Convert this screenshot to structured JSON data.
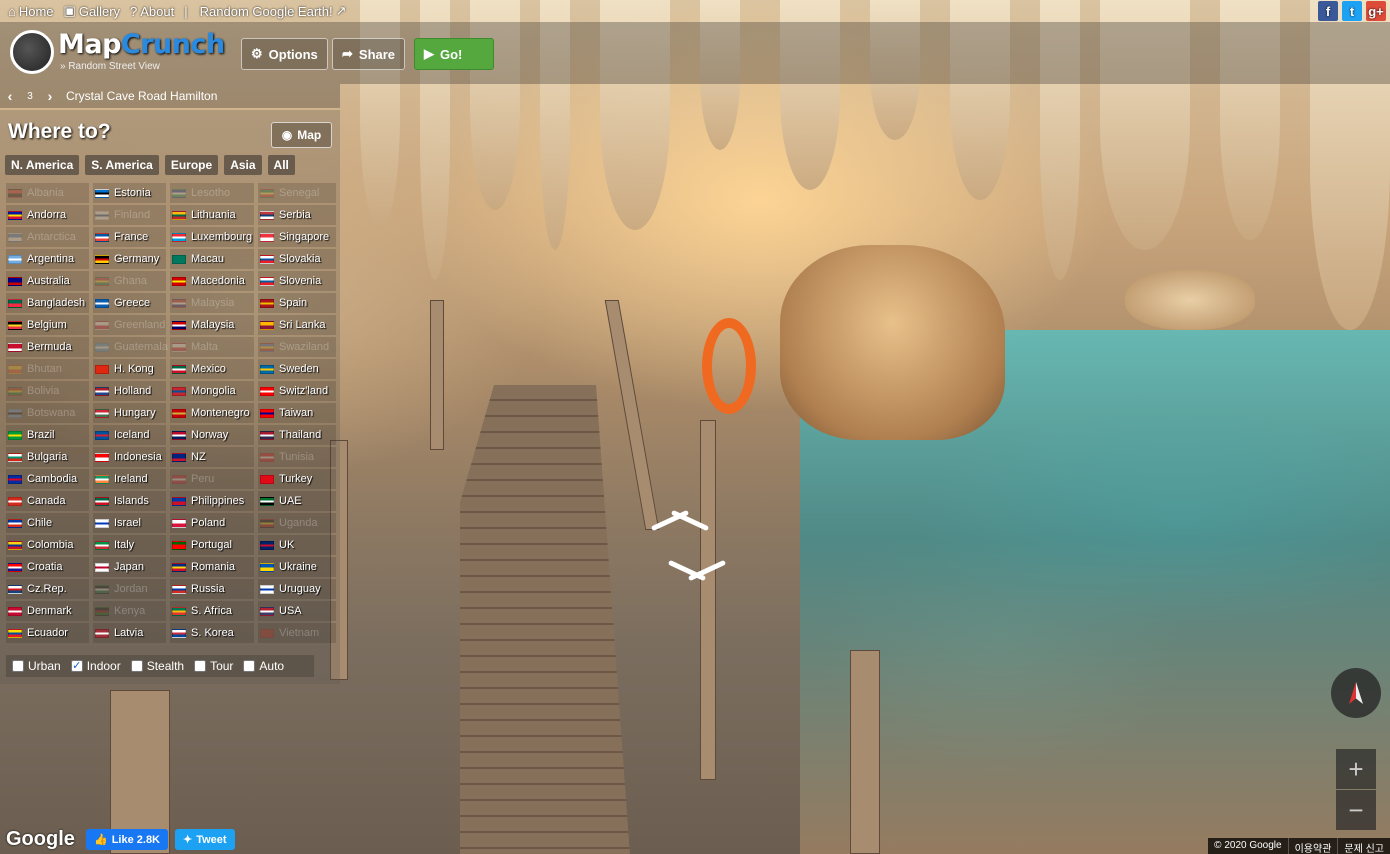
{
  "topnav": {
    "home": "Home",
    "gallery": "Gallery",
    "about": "About",
    "separator": "|",
    "random_earth": "Random Google Earth!"
  },
  "social": {
    "facebook": "f",
    "twitter": "t",
    "googleplus": "g+"
  },
  "header": {
    "logo_map": "Map",
    "logo_crunch": "Crunch",
    "tagline": "» Random Street View",
    "options": "Options",
    "share": "Share",
    "go": "Go!"
  },
  "location": {
    "page": "3",
    "name": "Crystal Cave Road Hamilton"
  },
  "where": {
    "title": "Where to?",
    "map": "Map",
    "regions": [
      "N. America",
      "S. America",
      "Europe",
      "Asia",
      "All"
    ],
    "options": [
      {
        "label": "Urban",
        "checked": false
      },
      {
        "label": "Indoor",
        "checked": true
      },
      {
        "label": "Stealth",
        "checked": false
      },
      {
        "label": "Tour",
        "checked": false
      },
      {
        "label": "Auto",
        "checked": false
      }
    ],
    "columns": [
      [
        {
          "name": "Albania",
          "dim": true,
          "colors": [
            "#e41e20",
            "#000"
          ]
        },
        {
          "name": "Andorra",
          "colors": [
            "#0018a8",
            "#fedf00",
            "#d0103a"
          ]
        },
        {
          "name": "Antarctica",
          "dim": true,
          "colors": [
            "#3a7dce",
            "#fff"
          ]
        },
        {
          "name": "Argentina",
          "colors": [
            "#74acdf",
            "#fff",
            "#74acdf"
          ]
        },
        {
          "name": "Australia",
          "colors": [
            "#00008b",
            "#00008b",
            "#c00"
          ]
        },
        {
          "name": "Bangladesh",
          "colors": [
            "#006a4e",
            "#f42a41"
          ]
        },
        {
          "name": "Belgium",
          "colors": [
            "#000",
            "#fdda24",
            "#ef3340"
          ]
        },
        {
          "name": "Bermuda",
          "colors": [
            "#c8102e",
            "#c8102e",
            "#fff"
          ]
        },
        {
          "name": "Bhutan",
          "dim": true,
          "colors": [
            "#ffd520",
            "#ff4e12"
          ]
        },
        {
          "name": "Bolivia",
          "dim": true,
          "colors": [
            "#d52b1e",
            "#f9e300",
            "#007934"
          ]
        },
        {
          "name": "Botswana",
          "dim": true,
          "colors": [
            "#75aadb",
            "#000",
            "#75aadb"
          ]
        },
        {
          "name": "Brazil",
          "colors": [
            "#009c3b",
            "#ffdf00",
            "#009c3b"
          ]
        },
        {
          "name": "Bulgaria",
          "colors": [
            "#fff",
            "#00966e",
            "#d62612"
          ]
        },
        {
          "name": "Cambodia",
          "colors": [
            "#032ea1",
            "#e00025",
            "#032ea1"
          ]
        },
        {
          "name": "Canada",
          "colors": [
            "#d52b1e",
            "#fff",
            "#d52b1e"
          ]
        },
        {
          "name": "Chile",
          "colors": [
            "#0039a6",
            "#fff",
            "#d52b1e"
          ]
        },
        {
          "name": "Colombia",
          "colors": [
            "#fcd116",
            "#003893",
            "#ce1126"
          ]
        },
        {
          "name": "Croatia",
          "colors": [
            "#ff0000",
            "#fff",
            "#171796"
          ]
        },
        {
          "name": "Cz.Rep.",
          "colors": [
            "#fff",
            "#d7141a",
            "#11457e"
          ]
        },
        {
          "name": "Denmark",
          "colors": [
            "#c60c30",
            "#fff",
            "#c60c30"
          ]
        },
        {
          "name": "Ecuador",
          "colors": [
            "#ffdd00",
            "#034ea2",
            "#ed1c24"
          ]
        }
      ],
      [
        {
          "name": "Estonia",
          "colors": [
            "#0072ce",
            "#000",
            "#fff"
          ]
        },
        {
          "name": "Finland",
          "dim": true,
          "colors": [
            "#fff",
            "#003580",
            "#fff"
          ]
        },
        {
          "name": "France",
          "colors": [
            "#0055a4",
            "#fff",
            "#ef4135"
          ]
        },
        {
          "name": "Germany",
          "colors": [
            "#000",
            "#dd0000",
            "#ffce00"
          ]
        },
        {
          "name": "Ghana",
          "dim": true,
          "colors": [
            "#ce1126",
            "#fcd116",
            "#006b3f"
          ]
        },
        {
          "name": "Greece",
          "colors": [
            "#0d5eaf",
            "#fff",
            "#0d5eaf"
          ]
        },
        {
          "name": "Greenland",
          "dim": true,
          "colors": [
            "#fff",
            "#d00c33"
          ]
        },
        {
          "name": "Guatemala",
          "dim": true,
          "colors": [
            "#4997d0",
            "#fff",
            "#4997d0"
          ]
        },
        {
          "name": "H. Kong",
          "colors": [
            "#de2910",
            "#de2910"
          ]
        },
        {
          "name": "Holland",
          "colors": [
            "#ae1c28",
            "#fff",
            "#21468b"
          ]
        },
        {
          "name": "Hungary",
          "colors": [
            "#ce2939",
            "#fff",
            "#477050"
          ]
        },
        {
          "name": "Iceland",
          "colors": [
            "#02529c",
            "#dc1e35",
            "#02529c"
          ]
        },
        {
          "name": "Indonesia",
          "colors": [
            "#ff0000",
            "#fff"
          ]
        },
        {
          "name": "Ireland",
          "colors": [
            "#169b62",
            "#fff",
            "#ff883e"
          ]
        },
        {
          "name": "Islands",
          "colors": [
            "#006847",
            "#fff",
            "#ce1126"
          ]
        },
        {
          "name": "Israel",
          "colors": [
            "#fff",
            "#0038b8",
            "#fff"
          ]
        },
        {
          "name": "Italy",
          "colors": [
            "#009246",
            "#fff",
            "#ce2b37"
          ]
        },
        {
          "name": "Japan",
          "colors": [
            "#fff",
            "#bc002d",
            "#fff"
          ]
        },
        {
          "name": "Jordan",
          "dim": true,
          "colors": [
            "#000",
            "#fff",
            "#007a3d"
          ]
        },
        {
          "name": "Kenya",
          "dim": true,
          "colors": [
            "#000",
            "#b00",
            "#006600"
          ]
        },
        {
          "name": "Latvia",
          "colors": [
            "#9e3039",
            "#fff",
            "#9e3039"
          ]
        }
      ],
      [
        {
          "name": "Lesotho",
          "dim": true,
          "colors": [
            "#00209f",
            "#fff",
            "#009543"
          ]
        },
        {
          "name": "Lithuania",
          "colors": [
            "#fdb913",
            "#006a44",
            "#c1272d"
          ]
        },
        {
          "name": "Luxembourg",
          "colors": [
            "#ed2939",
            "#fff",
            "#00a1de"
          ]
        },
        {
          "name": "Macau",
          "colors": [
            "#00785e",
            "#00785e"
          ]
        },
        {
          "name": "Macedonia",
          "colors": [
            "#d20000",
            "#ffe600",
            "#d20000"
          ]
        },
        {
          "name": "Malaysia",
          "dim": true,
          "colors": [
            "#cc0001",
            "#fff",
            "#010066"
          ]
        },
        {
          "name": "Malaysia",
          "colors": [
            "#cc0001",
            "#fff",
            "#010066"
          ]
        },
        {
          "name": "Malta",
          "dim": true,
          "colors": [
            "#fff",
            "#cf142b"
          ]
        },
        {
          "name": "Mexico",
          "colors": [
            "#006847",
            "#fff",
            "#ce1126"
          ]
        },
        {
          "name": "Mongolia",
          "colors": [
            "#c4272f",
            "#015197",
            "#c4272f"
          ]
        },
        {
          "name": "Montenegro",
          "colors": [
            "#c40308",
            "#d4af3a",
            "#c40308"
          ]
        },
        {
          "name": "Norway",
          "colors": [
            "#ba0c2f",
            "#fff",
            "#00205b"
          ]
        },
        {
          "name": "NZ",
          "colors": [
            "#00247d",
            "#00247d",
            "#cc142b"
          ]
        },
        {
          "name": "Peru",
          "dim": true,
          "colors": [
            "#d91023",
            "#fff",
            "#d91023"
          ]
        },
        {
          "name": "Philippines",
          "colors": [
            "#0038a8",
            "#ce1126"
          ]
        },
        {
          "name": "Poland",
          "colors": [
            "#fff",
            "#dc143c"
          ]
        },
        {
          "name": "Portugal",
          "colors": [
            "#006600",
            "#ff0000",
            "#ff0000"
          ]
        },
        {
          "name": "Romania",
          "colors": [
            "#002b7f",
            "#fcd116",
            "#ce1126"
          ]
        },
        {
          "name": "Russia",
          "colors": [
            "#fff",
            "#0039a6",
            "#d52b1e"
          ]
        },
        {
          "name": "S. Africa",
          "colors": [
            "#007a4d",
            "#ffb612",
            "#de3831"
          ]
        },
        {
          "name": "S. Korea",
          "colors": [
            "#fff",
            "#cd2e3a",
            "#0047a0"
          ]
        }
      ],
      [
        {
          "name": "Senegal",
          "dim": true,
          "colors": [
            "#00853f",
            "#fdef42",
            "#e31b23"
          ]
        },
        {
          "name": "Serbia",
          "colors": [
            "#c6363c",
            "#0c4076",
            "#fff"
          ]
        },
        {
          "name": "Singapore",
          "colors": [
            "#ef3340",
            "#fff"
          ]
        },
        {
          "name": "Slovakia",
          "colors": [
            "#fff",
            "#0b4ea2",
            "#ee1c25"
          ]
        },
        {
          "name": "Slovenia",
          "colors": [
            "#fff",
            "#005da4",
            "#ed1c24"
          ]
        },
        {
          "name": "Spain",
          "colors": [
            "#aa151b",
            "#f1bf00",
            "#aa151b"
          ]
        },
        {
          "name": "Sri Lanka",
          "colors": [
            "#ffb700",
            "#8d153a"
          ]
        },
        {
          "name": "Swaziland",
          "dim": true,
          "colors": [
            "#3e5eb9",
            "#ffd900",
            "#b10c0c"
          ]
        },
        {
          "name": "Sweden",
          "colors": [
            "#006aa7",
            "#fecc00",
            "#006aa7"
          ]
        },
        {
          "name": "Switz'land",
          "colors": [
            "#ff0000",
            "#fff",
            "#ff0000"
          ]
        },
        {
          "name": "Taiwan",
          "colors": [
            "#fe0000",
            "#000095",
            "#fe0000"
          ]
        },
        {
          "name": "Thailand",
          "colors": [
            "#a51931",
            "#f4f5f8",
            "#2d2a4a"
          ]
        },
        {
          "name": "Tunisia",
          "dim": true,
          "colors": [
            "#e70013",
            "#fff",
            "#e70013"
          ]
        },
        {
          "name": "Turkey",
          "colors": [
            "#e30a17",
            "#e30a17"
          ]
        },
        {
          "name": "UAE",
          "colors": [
            "#00732f",
            "#fff",
            "#000"
          ]
        },
        {
          "name": "Uganda",
          "dim": true,
          "colors": [
            "#000",
            "#fcdc04",
            "#d90000"
          ]
        },
        {
          "name": "UK",
          "colors": [
            "#012169",
            "#c8102e",
            "#012169"
          ]
        },
        {
          "name": "Ukraine",
          "colors": [
            "#0057b7",
            "#ffd700"
          ]
        },
        {
          "name": "Uruguay",
          "colors": [
            "#fff",
            "#0038a8",
            "#fff"
          ]
        },
        {
          "name": "USA",
          "colors": [
            "#b22234",
            "#fff",
            "#3c3b6e"
          ]
        },
        {
          "name": "Vietnam",
          "dim": true,
          "colors": [
            "#da251d",
            "#da251d"
          ]
        }
      ]
    ]
  },
  "bottom": {
    "google": "Google",
    "like": "Like 2.8K",
    "tweet": "Tweet",
    "copyright": "© 2020 Google",
    "terms": "이용약관",
    "report": "문제 신고"
  },
  "zoom": {
    "in": "+",
    "out": "−"
  }
}
